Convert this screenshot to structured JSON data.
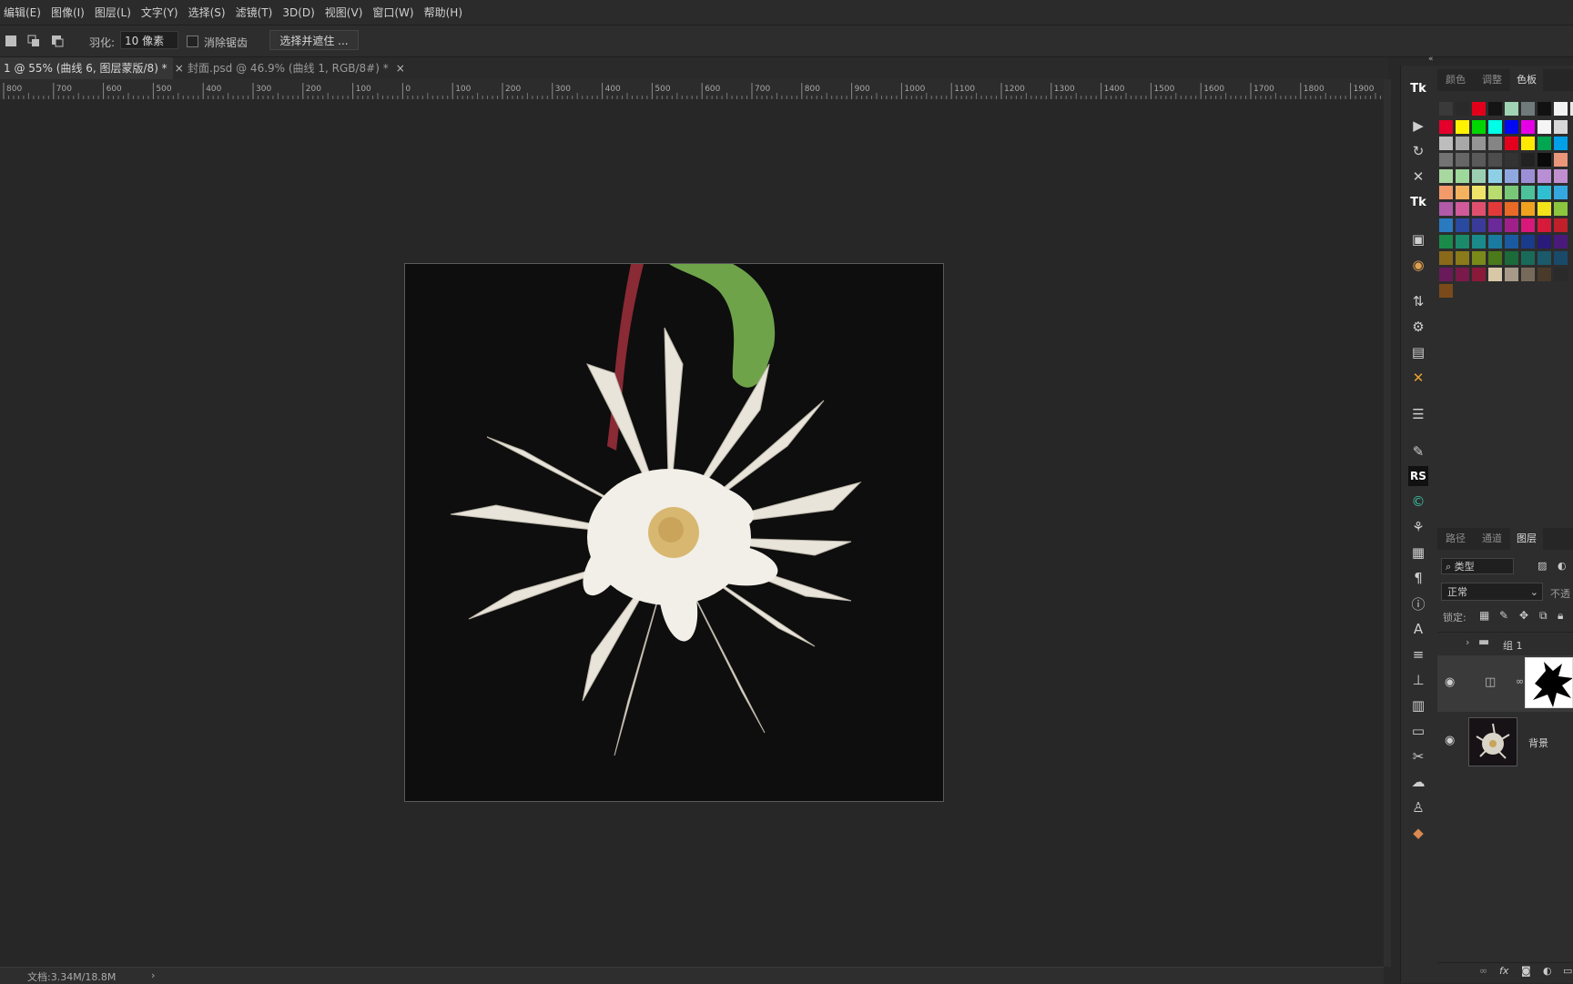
{
  "menu": [
    "编辑(E)",
    "图像(I)",
    "图层(L)",
    "文字(Y)",
    "选择(S)",
    "滤镜(T)",
    "3D(D)",
    "视图(V)",
    "窗口(W)",
    "帮助(H)"
  ],
  "options": {
    "feather_label": "羽化:",
    "feather_value": "10 像素",
    "antialias_label": "消除锯齿",
    "select_mask_button": "选择并遮住 ..."
  },
  "tabs": [
    {
      "label": "1 @ 55% (曲线 6, 图层蒙版/8) *",
      "close": "×"
    },
    {
      "label": "封面.psd @ 46.9% (曲线 1, RGB/8#) *",
      "close": "×"
    }
  ],
  "ruler_labels": [
    "800",
    "700",
    "600",
    "500",
    "400",
    "300",
    "200",
    "100",
    "0",
    "100",
    "200",
    "300",
    "400",
    "500",
    "600",
    "700",
    "800",
    "900",
    "1000",
    "1100",
    "1200",
    "1300",
    "1400",
    "1500",
    "1600",
    "1700",
    "1800",
    "1900"
  ],
  "status": {
    "doc": "文档:3.34M/18.8M",
    "arrow": "›"
  },
  "panel_top": {
    "tabs": [
      "颜色",
      "调整",
      "色板"
    ],
    "active": "色板"
  },
  "swatches": {
    "row0": [
      "#3a3a3a",
      "#2a2a2a",
      "#e1001a",
      "#141414",
      "#9fd3b4",
      "#707a7a",
      "#111111",
      "#f2f2f2",
      "#e8e8e8"
    ],
    "grid": [
      [
        "#e4002b",
        "#fff200",
        "#00d700",
        "#00ffe6",
        "#0009f2",
        "#e600e6",
        "#f5f5f5",
        "#d8d8d8"
      ],
      [
        "#bdbdbd",
        "#a8a8a8",
        "#959595",
        "#858585",
        "#e4001c",
        "#ffe900",
        "#00a650",
        "#00a0e9"
      ],
      [
        "#737373",
        "#666666",
        "#5a5a5a",
        "#4d4d4d",
        "#333333",
        "#222222",
        "#0a0a0a",
        "#e9967a"
      ],
      [
        "#a8d8a0",
        "#9ed89a",
        "#9ccfb2",
        "#8fcfe6",
        "#8fa8e0",
        "#9d8fd6",
        "#b88ed4",
        "#c08fd0"
      ],
      [
        "#f29a6a",
        "#f2b25e",
        "#f0e36a",
        "#b9dc6e",
        "#78c878",
        "#4dc29a",
        "#30bfd0",
        "#35a8e0"
      ],
      [
        "#b05aa8",
        "#d05a9a",
        "#e0506e",
        "#e23a3a",
        "#e86a26",
        "#f0a21e",
        "#f2e21a",
        "#8cc63e"
      ],
      [
        "#2a7ac0",
        "#2a4aa0",
        "#3a3a9a",
        "#6a2a9a",
        "#a0208a",
        "#d8187a",
        "#d81a3a",
        "#c0202a"
      ],
      [
        "#1a8a4a",
        "#1a8a6a",
        "#1a8a8a",
        "#1a7aa0",
        "#1a5aa0",
        "#1a3a8a",
        "#2a1a7a",
        "#4a1a7a"
      ],
      [
        "#8a6a1a",
        "#8a7a1a",
        "#7a8a1a",
        "#4a7a1a",
        "#1a6a3a",
        "#1a6a5a",
        "#1a5a6a",
        "#1a4a6a"
      ],
      [
        "#6a1a5a",
        "#7a1a4a",
        "#8a1a3a",
        "#d8c8a8",
        "#a89a88",
        "#786a5a",
        "#4a3a2a",
        "#2a2a2a"
      ],
      [
        "#7a4a1a"
      ]
    ]
  },
  "panel_layers": {
    "tabs": [
      "路径",
      "通道",
      "图层"
    ],
    "active": "图层",
    "filter_label": "类型",
    "blend_mode": "正常",
    "opacity_label": "不透",
    "lock_label": "锁定:",
    "layers": [
      {
        "name": "组 1",
        "type": "group"
      },
      {
        "name": "",
        "type": "curves-adjustment"
      },
      {
        "name": "背景",
        "type": "background"
      }
    ]
  },
  "toolstrip_icons": [
    "tk-icon",
    "play-icon",
    "rotate-icon",
    "brush-cross-icon",
    "tk-icon-2",
    "stamp-icon",
    "color-wheel-icon",
    "transform-icon",
    "gear-sprite-icon",
    "filmstrip-icon",
    "tools-cross-icon",
    "sliders-icon",
    "pen-path-icon",
    "rs-icon",
    "c-icon",
    "paint-icon",
    "grid-icon",
    "paragraph-icon",
    "info-icon",
    "text-icon",
    "list-icon",
    "stamp-2-icon",
    "layout-icon",
    "notes-icon",
    "scissors-icon",
    "cloud-icon",
    "brush-2-icon",
    "palette-icon"
  ]
}
